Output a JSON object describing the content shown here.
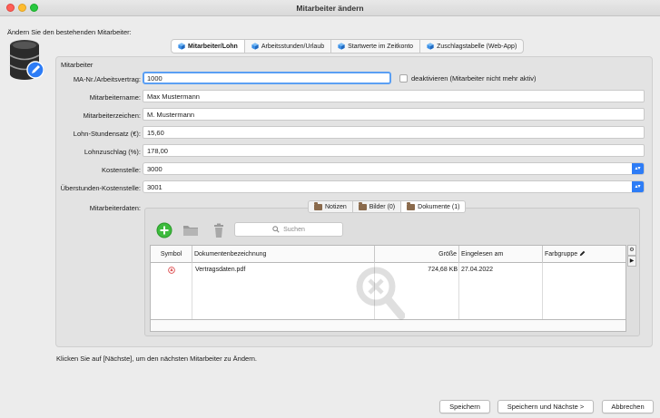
{
  "window": {
    "title": "Mitarbeiter ändern"
  },
  "intro_text": "Ändern Sie den bestehenden Mitarbeiter:",
  "main_tabs": [
    {
      "label": "Mitarbeiter/Lohn",
      "active": true
    },
    {
      "label": "Arbeitsstunden/Urlaub",
      "active": false
    },
    {
      "label": "Startwerte im Zeitkonto",
      "active": false
    },
    {
      "label": "Zuschlagstabelle (Web-App)",
      "active": false
    }
  ],
  "group_title": "Mitarbeiter",
  "form": {
    "ma_nr": {
      "label": "MA-Nr./Arbeitsvertrag:",
      "value": "1000"
    },
    "deactivate": {
      "label": "deaktivieren (Mitarbeiter nicht mehr aktiv)",
      "checked": false
    },
    "name": {
      "label": "Mitarbeitername:",
      "value": "Max Mustermann"
    },
    "zeichen": {
      "label": "Mitarbeiterzeichen:",
      "value": "M. Mustermann"
    },
    "stundensatz": {
      "label": "Lohn-Stundensatz (€):",
      "value": "15,60"
    },
    "lohnzuschlag": {
      "label": "Lohnzuschlag (%):",
      "value": "178,00"
    },
    "kostenstelle": {
      "label": "Kostenstelle:",
      "value": "3000"
    },
    "ueberstunden_kostenstelle": {
      "label": "Überstunden-Kostenstelle:",
      "value": "3001"
    },
    "mitarbeiterdaten": {
      "label": "Mitarbeiterdaten:"
    }
  },
  "sub_tabs": [
    {
      "label": "Notizen",
      "active": false
    },
    {
      "label": "Bilder (0)",
      "active": false
    },
    {
      "label": "Dokumente (1)",
      "active": true
    }
  ],
  "search": {
    "placeholder": "Suchen"
  },
  "table": {
    "columns": [
      "Symbol",
      "Dokumentenbezeichnung",
      "Größe",
      "Eingelesen am",
      "Farbgruppe"
    ],
    "rows": [
      {
        "name": "Vertragsdaten.pdf",
        "size": "724,68 KB",
        "date": "27.04.2022",
        "color_group": ""
      }
    ]
  },
  "hint_text": "Klicken Sie auf [Nächste], um den nächsten Mitarbeiter zu Ändern.",
  "buttons": {
    "save": "Speichern",
    "save_next": "Speichern und Nächste >",
    "cancel": "Abbrechen"
  },
  "colors": {
    "accent": "#2d7cf6",
    "focus": "#5a9ff4",
    "add_green": "#3dbb3d",
    "pdf_red": "#d9383a"
  }
}
